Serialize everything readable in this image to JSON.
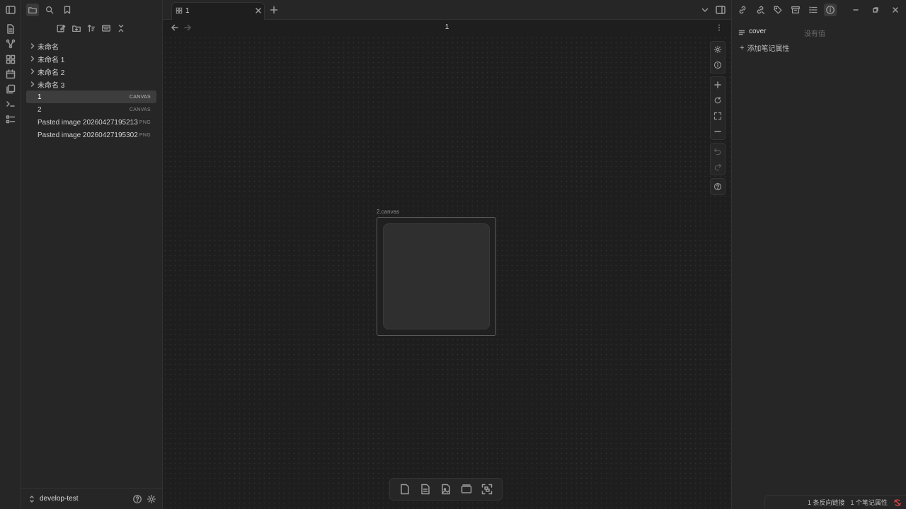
{
  "tab": {
    "title": "1"
  },
  "view": {
    "title": "1"
  },
  "file_tree": [
    {
      "name": "未命名",
      "type": "folder"
    },
    {
      "name": "未命名 1",
      "type": "folder"
    },
    {
      "name": "未命名 2",
      "type": "folder"
    },
    {
      "name": "未命名 3",
      "type": "folder"
    },
    {
      "name": "1",
      "type": "file",
      "badge": "CANVAS",
      "active": true
    },
    {
      "name": "2",
      "type": "file",
      "badge": "CANVAS"
    },
    {
      "name": "Pasted image 20260427195213",
      "type": "file",
      "badge": "PNG"
    },
    {
      "name": "Pasted image 20260427195302",
      "type": "file",
      "badge": "PNG"
    }
  ],
  "vault": {
    "name": "develop-test"
  },
  "canvas": {
    "node_label": "2.canvas"
  },
  "properties": {
    "name": "cover",
    "value_placeholder": "没有值",
    "add_label": "添加笔记属性"
  },
  "status": {
    "backlinks": "1 条反向链接",
    "properties": "1 个笔记属性"
  },
  "colors": {
    "background": "#1e1e1e",
    "panel": "#262626",
    "sync_error": "#e5484d"
  }
}
